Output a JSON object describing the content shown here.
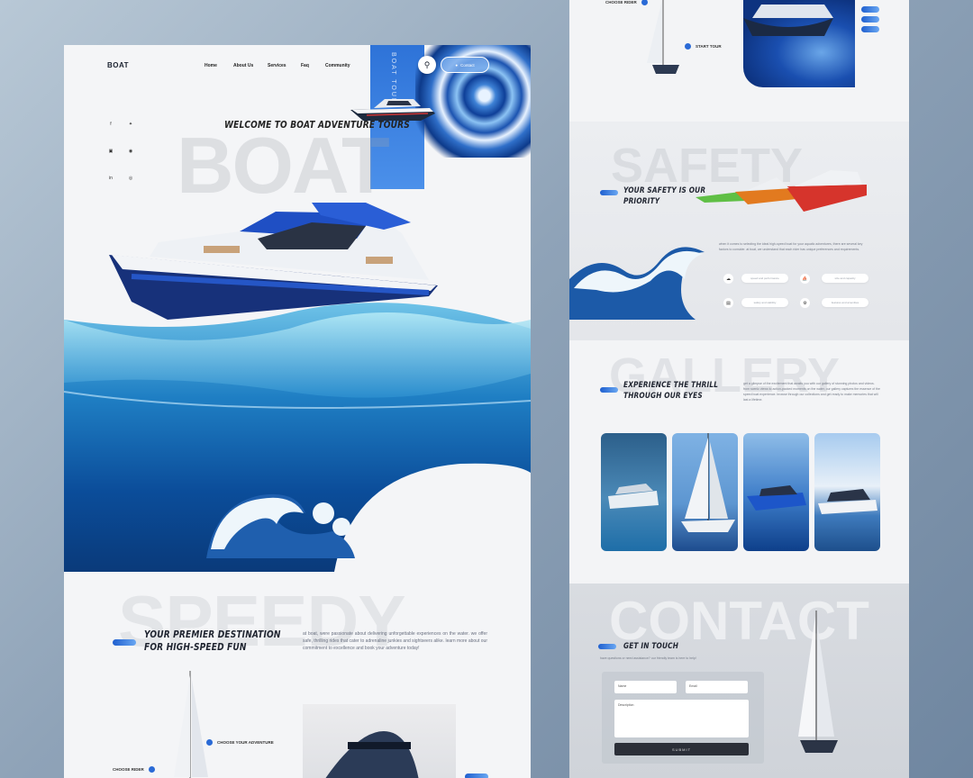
{
  "colors": {
    "accent": "#2a6ad6",
    "deep_blue": "#0e3f98",
    "dark_button": "#2b2f38",
    "background": "#8fa3b8"
  },
  "header": {
    "logo": "BOAT",
    "nav": [
      "Home",
      "About Us",
      "Services",
      "Faq",
      "Community"
    ],
    "contact_label": "Contact",
    "search_icon": "search-icon",
    "strip_text": "BOAT TOUR"
  },
  "social": [
    "facebook-icon",
    "twitter-icon",
    "instagram-icon",
    "camera-icon",
    "linkedin-icon",
    "pinterest-icon"
  ],
  "hero": {
    "welcome": "WELCOME TO BOAT ADVENTURE TOURS",
    "big_word": "BOAT"
  },
  "speedy": {
    "big_word": "SPEEDY",
    "title_line1": "YOUR PREMIER DESTINATION",
    "title_line2": "FOR HIGH-SPEED FUN",
    "body": "at boat, were passionate about delivering unforgettable experiences on the water. we offer safe, thrilling rides that cater to adrenaline junkies and sightseers alike. learn more about our commitment to excellence and book your adventure today!",
    "choose_adventure": "CHOOSE YOUR ADVENTURE",
    "choose_rider": "CHOOSE RIDER"
  },
  "top_right": {
    "choose_rider": "CHOOSE RIDER",
    "start_tour": "START TOUR"
  },
  "safety": {
    "big_word": "SAFETY",
    "title_line1": "YOUR SAFETY IS OUR",
    "title_line2": "PRIORITY",
    "body": "when it comes to selecting the ideal high-speed boat for your aquatic adventures, there are several key factors to consider. at boat, we understand that each rider has unique preferences and requirements.",
    "features": [
      "speed and performance",
      "size and capacity",
      "safety and stability",
      "features and amenities"
    ]
  },
  "gallery": {
    "big_word": "GALLERY",
    "title_line1": "EXPERIENCE THE THRILL",
    "title_line2": "THROUGH OUR EYES",
    "body": "get a glimpse of the excitement that awaits you with our gallery of stunning photos and videos. from scenic views to action-packed moments on the water, our gallery captures the essence of the speed boat experience. browse through our collections and get ready to make memories that will last a lifetime."
  },
  "contact": {
    "big_word": "CONTACT",
    "title": "GET IN TOUCH",
    "body": "have questions or need assistance? our friendly team is here to help!",
    "name_placeholder": "Name",
    "email_placeholder": "Email",
    "description_placeholder": "Description",
    "submit": "SUBMIT"
  }
}
